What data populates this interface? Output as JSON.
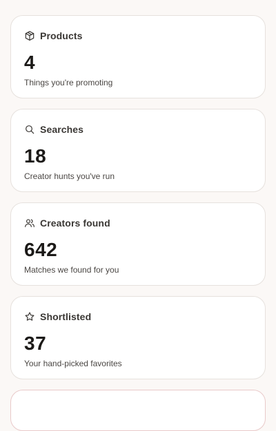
{
  "stats": [
    {
      "label": "Products",
      "value": "4",
      "caption": "Things you're promoting",
      "icon": "box-icon"
    },
    {
      "label": "Searches",
      "value": "18",
      "caption": "Creator hunts you've run",
      "icon": "search-icon"
    },
    {
      "label": "Creators found",
      "value": "642",
      "caption": "Matches we found for you",
      "icon": "users-icon"
    },
    {
      "label": "Shortlisted",
      "value": "37",
      "caption": "Your hand-picked favorites",
      "icon": "star-icon"
    }
  ],
  "colors": {
    "background": "#fbf8f6",
    "card": "#ffffff",
    "card_border": "#e6e1dd",
    "partial_card_border": "#e9c9c9",
    "text_primary": "#1c1a18",
    "text_secondary": "#4a4643"
  }
}
